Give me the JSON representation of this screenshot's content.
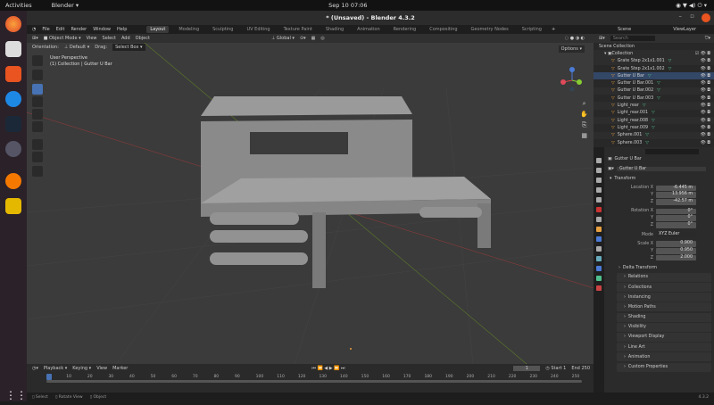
{
  "system": {
    "activities": "Activities",
    "app_menu": "Blender ▾",
    "clock": "Sep 10  07:06"
  },
  "window": {
    "title": "* (Unsaved) - Blender 4.3.2"
  },
  "menu": [
    "File",
    "Edit",
    "Render",
    "Window",
    "Help"
  ],
  "workspaces": [
    "Layout",
    "Modeling",
    "Sculpting",
    "UV Editing",
    "Texture Paint",
    "Shading",
    "Animation",
    "Rendering",
    "Compositing",
    "Geometry Nodes",
    "Scripting"
  ],
  "active_workspace": "Layout",
  "viewport": {
    "mode": "Object Mode",
    "menus": [
      "View",
      "Select",
      "Add",
      "Object"
    ],
    "orientation_label": "Orientation:",
    "orientation": "Default",
    "drag_label": "Drag:",
    "drag": "Select Box",
    "transform_orientation": "Global",
    "options": "Options",
    "overlay_line1": "User Perspective",
    "overlay_line2": "(1) Collection | Gutter U Bar"
  },
  "outliner": {
    "scene": "Scene",
    "view_layer": "ViewLayer",
    "search_placeholder": "Search",
    "scene_collection": "Scene Collection",
    "collection": "Collection",
    "items": [
      "Grate Step 2x1x1.001",
      "Grate Step 2x1x1.002",
      "Gutter U Bar",
      "Gutter U Bar.001",
      "Gutter U Bar.002",
      "Gutter U Bar.003",
      "Light_rear",
      "Light_rear.001",
      "Light_rear.008",
      "Light_rear.009",
      "Sphere.001",
      "Sphere.003"
    ]
  },
  "properties": {
    "object_name": "Gutter U Bar",
    "data_name": "Gutter U Bar",
    "transform": "Transform",
    "location_label": "Location X",
    "location": [
      "-6.445 m",
      "13.956 m",
      "-42.57 m"
    ],
    "rotation_label": "Rotation X",
    "rotation": [
      "0°",
      "0°",
      "0°"
    ],
    "mode_label": "Mode",
    "mode": "XYZ Euler",
    "scale_label": "Scale X",
    "scale": [
      "0.900",
      "0.950",
      "2.000"
    ],
    "axis_y": "Y",
    "axis_z": "Z",
    "delta": "Delta Transform",
    "panels": [
      "Relations",
      "Collections",
      "Instancing",
      "Motion Paths",
      "Shading",
      "Visibility",
      "Viewport Display",
      "Line Art",
      "Animation",
      "Custom Properties"
    ]
  },
  "timeline": {
    "menus": [
      "Playback ▾",
      "Keying ▾",
      "View",
      "Marker"
    ],
    "current_frame": "1",
    "start_label": "Start",
    "start": "1",
    "end_label": "End",
    "end": "250",
    "ticks": [
      "1",
      "10",
      "20",
      "30",
      "40",
      "50",
      "60",
      "70",
      "80",
      "90",
      "100",
      "110",
      "120",
      "130",
      "140",
      "150",
      "160",
      "170",
      "180",
      "190",
      "200",
      "210",
      "220",
      "230",
      "240",
      "250"
    ]
  },
  "status": {
    "items": [
      "Select",
      "Rotate View",
      "Object"
    ],
    "version": "4.3.2"
  }
}
